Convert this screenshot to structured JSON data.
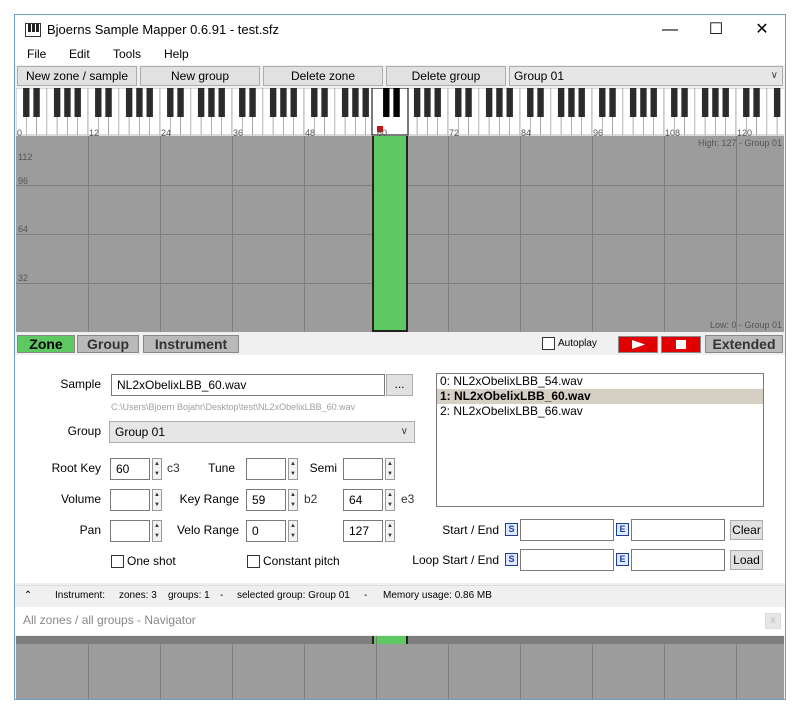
{
  "window": {
    "title": "Bjoerns Sample Mapper 0.6.91 - test.sfz",
    "minimize": "—",
    "maximize": "☐",
    "close": "✕"
  },
  "menu": [
    "File",
    "Edit",
    "Tools",
    "Help"
  ],
  "toolbar": {
    "new_zone": "New zone / sample",
    "new_group": "New group",
    "delete_zone": "Delete zone",
    "delete_group": "Delete group",
    "group_selected": "Group 01"
  },
  "keyboard": {
    "note_labels": [
      "0",
      "12",
      "24",
      "36",
      "48",
      "60",
      "72",
      "84",
      "96",
      "108",
      "120"
    ]
  },
  "map": {
    "velocity_labels": [
      "112",
      "96",
      "64",
      "32"
    ],
    "high_label": "High: 127 - Group 01",
    "low_label": "Low: 0 - Group 01"
  },
  "tabs": {
    "zone": "Zone",
    "group": "Group",
    "instrument": "Instrument",
    "autoplay": "Autoplay",
    "extended": "Extended"
  },
  "zone": {
    "sample_label": "Sample",
    "sample_value": "NL2xObelixLBB_60.wav",
    "browse": "...",
    "sample_path": "C:\\Users\\Bjoern Bojahr\\Desktop\\test\\NL2xObelixLBB_60.wav",
    "group_label": "Group",
    "group_value": "Group 01",
    "root_key_label": "Root Key",
    "root_key_value": "60",
    "root_key_note": "c3",
    "tune_label": "Tune",
    "tune_value": "",
    "semi_label": "Semi",
    "semi_value": "",
    "volume_label": "Volume",
    "volume_value": "",
    "key_range_label": "Key Range",
    "key_low": "59",
    "key_low_note": "b2",
    "key_high": "64",
    "key_high_note": "e3",
    "pan_label": "Pan",
    "pan_value": "",
    "velo_range_label": "Velo Range",
    "velo_low": "0",
    "velo_high": "127",
    "one_shot": "One shot",
    "constant_pitch": "Constant pitch",
    "files": [
      {
        "label": "0: NL2xObelixLBB_54.wav",
        "selected": false
      },
      {
        "label": "1: NL2xObelixLBB_60.wav",
        "selected": true
      },
      {
        "label": "2: NL2xObelixLBB_66.wav",
        "selected": false
      }
    ],
    "start_end_label": "Start / End",
    "loop_start_end_label": "Loop Start / End",
    "s_btn": "S",
    "e_btn": "E",
    "clear": "Clear",
    "load": "Load"
  },
  "status": {
    "arrow": "⌃",
    "instrument": "Instrument:",
    "zones": "zones: 3",
    "groups": "groups: 1",
    "sep": "-",
    "selected_group": "selected group: Group 01",
    "memory": "Memory usage: 0.86 MB"
  },
  "navigator": {
    "title": "All zones / all groups - Navigator",
    "close": "x"
  },
  "colors": {
    "zone_green": "#5ec862",
    "map_gray": "#9c9c9c",
    "play_red": "#e00000"
  }
}
